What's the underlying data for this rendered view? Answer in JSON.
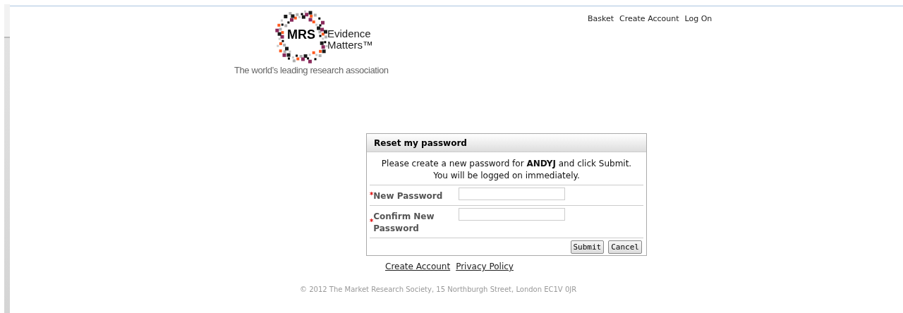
{
  "logo": {
    "mark": "MRS",
    "line1": "Evidence",
    "line2": "Matters™",
    "tagline": "The world’s leading research association"
  },
  "nav": [
    "Basket",
    "Create Account",
    "Log On"
  ],
  "dialog": {
    "title": "Reset my password",
    "message": "Please create a new password for **ANDYJ** and click Submit. You will be logged on immediately.",
    "fields": [
      {
        "marker": "*",
        "label": "New Password"
      },
      {
        "marker": "*",
        "label": "Confirm New Password"
      }
    ],
    "buttons": [
      "Submit",
      "Cancel"
    ]
  },
  "links": [
    "Create Account",
    "Privacy Policy"
  ],
  "footer": "© 2012 The Market Research Society, 15 Northburgh Street, London EC1V 0JR"
}
